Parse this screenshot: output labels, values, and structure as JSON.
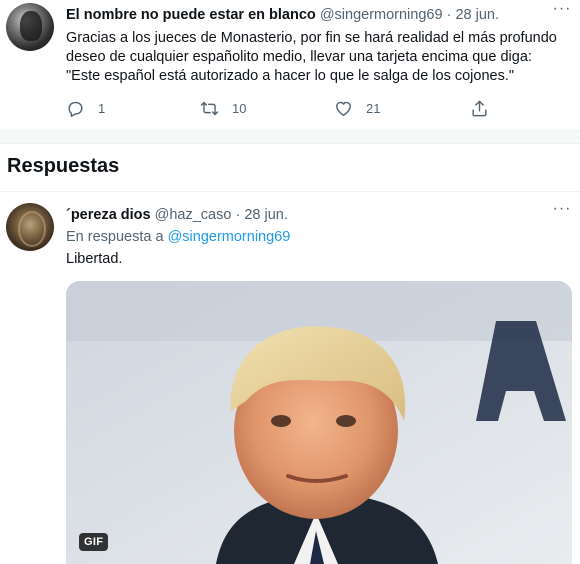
{
  "tweet": {
    "author_name": "El nombre no puede estar en blanco",
    "handle": "@singermorning69",
    "separator": "·",
    "date": "28 jun.",
    "text_lines": [
      "Gracias a los jueces de Monasterio, por fin se hará realidad el más profundo",
      "deseo de cualquier españolito medio, llevar una tarjeta encima que diga:",
      "\"Este español está autorizado a hacer lo que le salga de los cojones.\""
    ],
    "actions": {
      "reply_count": "1",
      "retweet_count": "10",
      "like_count": "21"
    }
  },
  "section": {
    "title": "Respuestas"
  },
  "reply": {
    "author_name": "´pereza dios",
    "handle": "@haz_caso",
    "separator": "·",
    "date": "28 jun.",
    "in_reply_prefix": "En respuesta a",
    "in_reply_handle": "@singermorning69",
    "text": "Libertad.",
    "media_badge": "GIF"
  },
  "colors": {
    "accent": "#1d9bf0",
    "secondary_text": "#536471",
    "primary_text": "#0f1419"
  },
  "icons": {
    "reply": "reply-icon",
    "retweet": "retweet-icon",
    "like": "heart-icon",
    "share": "share-icon",
    "more": "more-dots-icon"
  }
}
